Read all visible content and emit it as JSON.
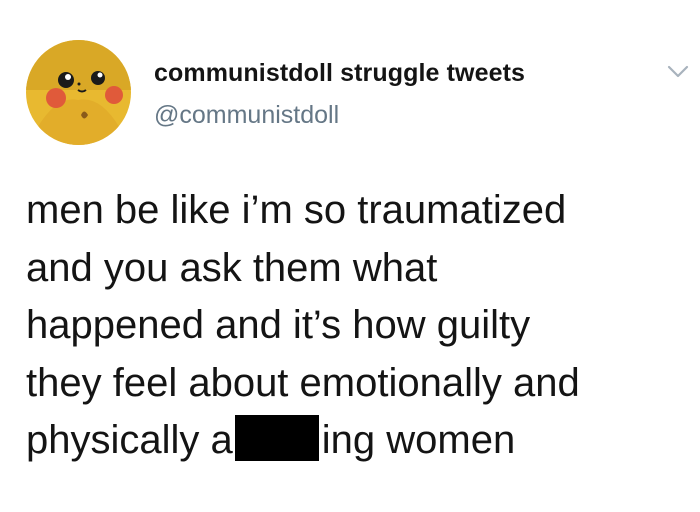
{
  "tweet": {
    "author": {
      "display_name": "communistdoll struggle tweets",
      "handle": "@communistdoll",
      "avatar_icon": "pikachu-avatar-icon"
    },
    "menu_icon": "chevron-down-icon",
    "body_lines": [
      "men be like i’m so traumatized",
      "and you ask them what",
      "happened and it’s how guilty",
      "they feel about emotionally and"
    ],
    "last_line": {
      "before_redaction": "physically a",
      "after_redaction": "ing women"
    }
  },
  "colors": {
    "text": "#141414",
    "handle": "#657786",
    "background": "#ffffff",
    "redaction": "#000000"
  }
}
